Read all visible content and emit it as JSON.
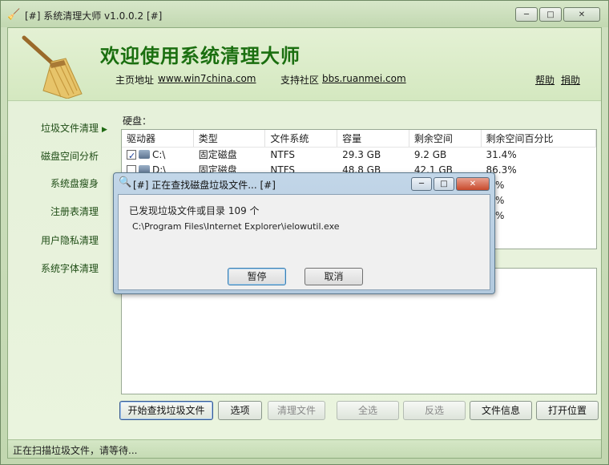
{
  "window": {
    "title": "[#] 系统清理大师 v1.0.0.2 [#]",
    "icon": "broom-icon",
    "minimize_glyph": "─",
    "maximize_glyph": "□",
    "close_glyph": "✕"
  },
  "header": {
    "app_title": "欢迎使用系统清理大师",
    "homepage_label": "主页地址",
    "homepage_url": "www.win7china.com",
    "community_label": "支持社区",
    "community_url": "bbs.ruanmei.com",
    "help": "帮助",
    "donate": "捐助"
  },
  "sidebar": {
    "items": [
      {
        "label": "垃圾文件清理",
        "active": true
      },
      {
        "label": "磁盘空间分析",
        "active": false
      },
      {
        "label": "系统盘瘦身",
        "active": false
      },
      {
        "label": "注册表清理",
        "active": false
      },
      {
        "label": "用户隐私清理",
        "active": false
      },
      {
        "label": "系统字体清理",
        "active": false
      }
    ]
  },
  "disks": {
    "label": "硬盘：",
    "columns": [
      "驱动器",
      "类型",
      "文件系统",
      "容量",
      "剩余空间",
      "剩余空间百分比"
    ],
    "rows": [
      {
        "checked": true,
        "drive": "C:\\",
        "type": "固定磁盘",
        "fs": "NTFS",
        "capacity": "29.3 GB",
        "free": "9.2 GB",
        "percent": "31.4%"
      },
      {
        "checked": false,
        "drive": "D:\\",
        "type": "固定磁盘",
        "fs": "NTFS",
        "capacity": "48.8 GB",
        "free": "42.1 GB",
        "percent": "86.3%"
      },
      {
        "checked": false,
        "drive": "",
        "type": "",
        "fs": "",
        "capacity": "",
        "free": "",
        "percent": ".7%"
      },
      {
        "checked": false,
        "drive": "",
        "type": "",
        "fs": "",
        "capacity": "",
        "free": "",
        "percent": ".7%"
      },
      {
        "checked": false,
        "drive": "",
        "type": "",
        "fs": "",
        "capacity": "",
        "free": "",
        "percent": ".6%"
      }
    ]
  },
  "buttons": {
    "start_scan": "开始查找垃圾文件",
    "options": "选项",
    "clean": "清理文件",
    "select_all": "全选",
    "invert": "反选",
    "file_info": "文件信息",
    "open_location": "打开位置"
  },
  "status": {
    "text": "正在扫描垃圾文件，请等待..."
  },
  "dialog": {
    "title": "[#] 正在查找磁盘垃圾文件... [#]",
    "icon": "magnifier-icon",
    "found_text": "已发现垃圾文件或目录 109 个",
    "current_path": "C:\\Program Files\\Internet Explorer\\ielowutil.exe",
    "pause": "暂停",
    "cancel": "取消",
    "minimize_glyph": "─",
    "maximize_glyph": "□",
    "close_glyph": "✕"
  },
  "colors": {
    "title_green": "#1b6f10",
    "frame_green": "#c9dcb8",
    "dialog_blue": "#b2c9de"
  }
}
